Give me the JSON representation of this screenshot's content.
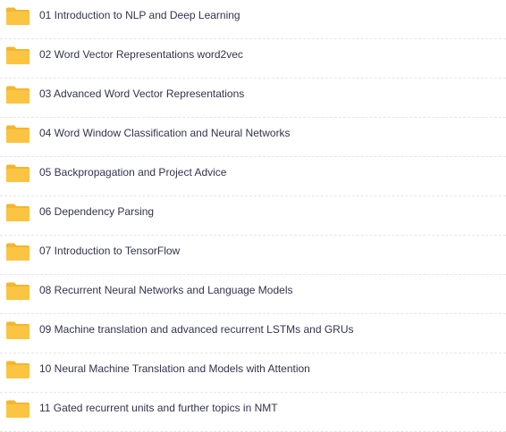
{
  "folders": [
    {
      "name": "01 Introduction to NLP and Deep Learning",
      "icon": "folder-icon"
    },
    {
      "name": "02 Word Vector Representations word2vec",
      "icon": "folder-icon"
    },
    {
      "name": "03 Advanced Word Vector Representations",
      "icon": "folder-icon"
    },
    {
      "name": "04 Word Window Classification and Neural Networks",
      "icon": "folder-icon"
    },
    {
      "name": "05 Backpropagation and Project Advice",
      "icon": "folder-icon"
    },
    {
      "name": "06 Dependency Parsing",
      "icon": "folder-icon"
    },
    {
      "name": "07 Introduction to TensorFlow",
      "icon": "folder-icon"
    },
    {
      "name": "08 Recurrent Neural Networks and Language Models",
      "icon": "folder-icon"
    },
    {
      "name": "09 Machine translation and advanced recurrent LSTMs and GRUs",
      "icon": "folder-icon"
    },
    {
      "name": "10 Neural Machine Translation and Models with Attention",
      "icon": "folder-icon"
    },
    {
      "name": "11 Gated recurrent units and further topics in NMT",
      "icon": "folder-icon"
    }
  ],
  "colors": {
    "folder": "#fcc443",
    "folder_back": "#f2b62f",
    "text": "#33334d"
  }
}
